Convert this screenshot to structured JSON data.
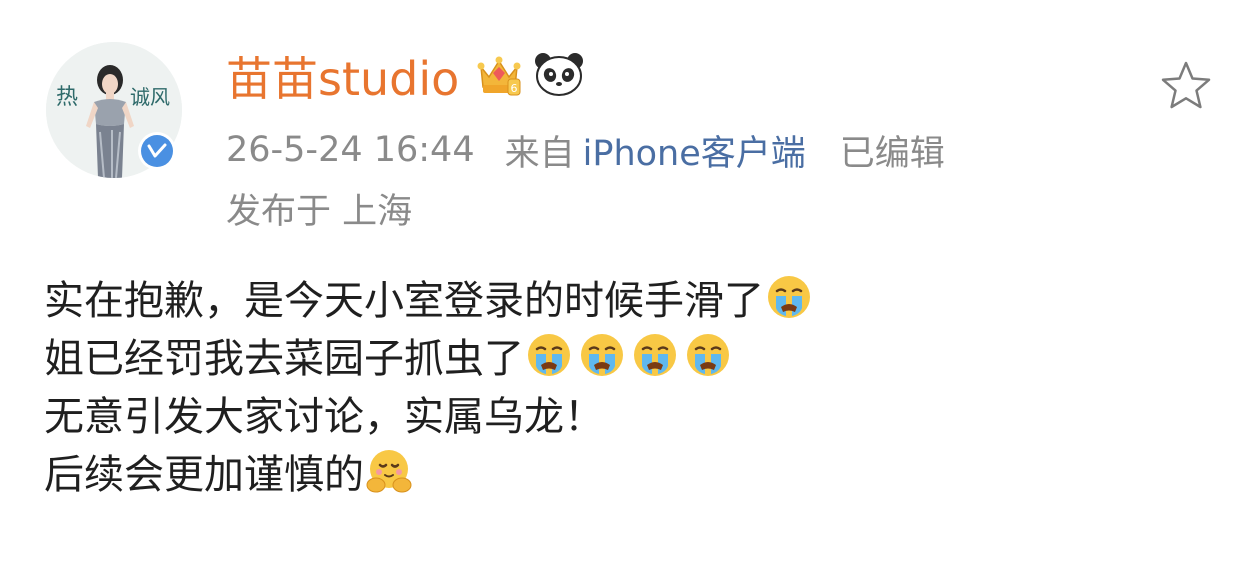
{
  "post": {
    "author": {
      "name": "苗苗studio",
      "avatar_text": "热",
      "avatar_text_2": "诚风"
    },
    "meta": {
      "timestamp": "26-5-24 16:44",
      "source_prefix": "来自",
      "source": "iPhone客户端",
      "edited": "已编辑"
    },
    "location": "发布于 上海",
    "lines": [
      {
        "text": "实在抱歉，是今天小室登录的时候手滑了",
        "emojis": [
          "crying-face-icon"
        ]
      },
      {
        "text": "姐已经罚我去菜园子抓虫了",
        "emojis": [
          "crying-face-icon",
          "crying-face-icon",
          "crying-face-icon",
          "crying-face-icon"
        ]
      },
      {
        "text": "无意引发大家讨论，实属乌龙！",
        "emojis": []
      },
      {
        "text": "后续会更加谨慎的",
        "emojis": [
          "hugging-face-icon"
        ]
      }
    ],
    "colors": {
      "username": "#e8752f",
      "meta": "#8a8a8a",
      "source_link": "#4a6ea3",
      "verified": "#4a90e2",
      "body_text": "#1f1f1f"
    }
  }
}
